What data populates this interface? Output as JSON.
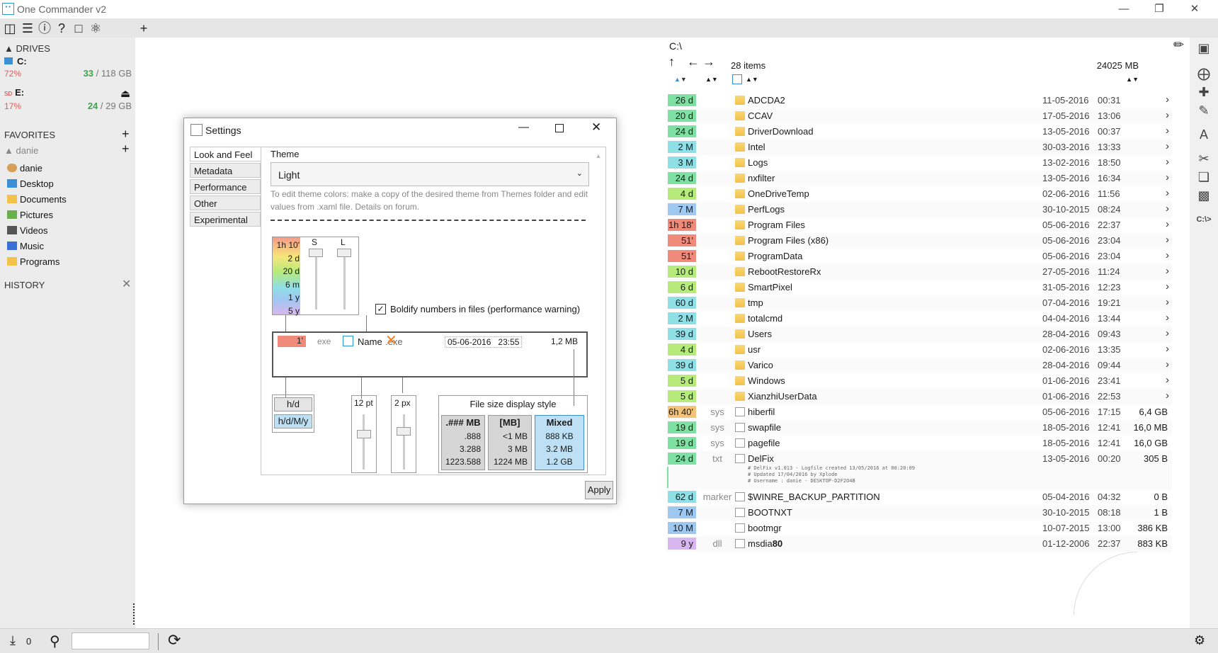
{
  "window": {
    "title": "One Commander v2"
  },
  "sidebar": {
    "drives_header": "DRIVES",
    "drives": [
      {
        "letter": "C:",
        "percent": "72%",
        "used": "33",
        "total": " / 118 GB"
      },
      {
        "letter": "E:",
        "percent": "17%",
        "used": "24",
        "total": " / 29 GB",
        "badge": "SD"
      }
    ],
    "favorites_header": "FAVORITES",
    "user": "danie",
    "items": [
      "danie",
      "Desktop",
      "Documents",
      "Pictures",
      "Videos",
      "Music",
      "Programs"
    ],
    "history_header": "HISTORY"
  },
  "statusbar": {
    "count": "0"
  },
  "rightpanel": {
    "path": "C:\\",
    "items_count": "28 items",
    "free_space": "24025 MB",
    "rows": [
      {
        "age": "26 d",
        "color": "#7ee0a3",
        "ext": "",
        "type": "folder",
        "name": "ADCDA2",
        "date": "11-05-2016",
        "time": "00:31",
        "size": ""
      },
      {
        "age": "20 d",
        "color": "#7ee0a3",
        "ext": "",
        "type": "folder",
        "name": "CCAV",
        "date": "17-05-2016",
        "time": "13:06",
        "size": ""
      },
      {
        "age": "24 d",
        "color": "#7ee0a3",
        "ext": "",
        "type": "folder",
        "name": "DriverDownload",
        "date": "13-05-2016",
        "time": "00:37",
        "size": ""
      },
      {
        "age": "2 M",
        "color": "#8fdfe6",
        "ext": "",
        "type": "folder",
        "name": "Intel",
        "date": "30-03-2016",
        "time": "13:33",
        "size": ""
      },
      {
        "age": "3 M",
        "color": "#8fdfe6",
        "ext": "",
        "type": "folder",
        "name": "Logs",
        "date": "13-02-2016",
        "time": "18:50",
        "size": ""
      },
      {
        "age": "24 d",
        "color": "#7ee0a3",
        "ext": "",
        "type": "folder",
        "name": "nxfilter",
        "date": "13-05-2016",
        "time": "16:34",
        "size": ""
      },
      {
        "age": "4 d",
        "color": "#b6ea7a",
        "ext": "",
        "type": "folder",
        "name": "OneDriveTemp",
        "date": "02-06-2016",
        "time": "11:56",
        "size": ""
      },
      {
        "age": "7 M",
        "color": "#9fc8f0",
        "ext": "",
        "type": "folder",
        "name": "PerfLogs",
        "date": "30-10-2015",
        "time": "08:24",
        "size": ""
      },
      {
        "age": "1h 18'",
        "color": "#f08a7a",
        "ext": "",
        "type": "folder",
        "name": "Program Files",
        "date": "05-06-2016",
        "time": "22:37",
        "size": ""
      },
      {
        "age": "51'",
        "color": "#f08a7a",
        "ext": "",
        "type": "folder",
        "name": "Program Files (x86)",
        "date": "05-06-2016",
        "time": "23:04",
        "size": ""
      },
      {
        "age": "51'",
        "color": "#f08a7a",
        "ext": "",
        "type": "folder",
        "name": "ProgramData",
        "date": "05-06-2016",
        "time": "23:04",
        "size": ""
      },
      {
        "age": "10 d",
        "color": "#b6ea7a",
        "ext": "",
        "type": "folder",
        "name": "RebootRestoreRx",
        "date": "27-05-2016",
        "time": "11:24",
        "size": ""
      },
      {
        "age": "6 d",
        "color": "#b6ea7a",
        "ext": "",
        "type": "folder",
        "name": "SmartPixel",
        "date": "31-05-2016",
        "time": "12:23",
        "size": ""
      },
      {
        "age": "60 d",
        "color": "#8fdfe6",
        "ext": "",
        "type": "folder",
        "name": "tmp",
        "date": "07-04-2016",
        "time": "19:21",
        "size": ""
      },
      {
        "age": "2 M",
        "color": "#8fdfe6",
        "ext": "",
        "type": "folder",
        "name": "totalcmd",
        "date": "04-04-2016",
        "time": "13:44",
        "size": ""
      },
      {
        "age": "39 d",
        "color": "#8fdfe6",
        "ext": "",
        "type": "folder",
        "name": "Users",
        "date": "28-04-2016",
        "time": "09:43",
        "size": ""
      },
      {
        "age": "4 d",
        "color": "#b6ea7a",
        "ext": "",
        "type": "folder",
        "name": "usr",
        "date": "02-06-2016",
        "time": "13:35",
        "size": ""
      },
      {
        "age": "39 d",
        "color": "#8fdfe6",
        "ext": "",
        "type": "folder",
        "name": "Varico",
        "date": "28-04-2016",
        "time": "09:44",
        "size": ""
      },
      {
        "age": "5 d",
        "color": "#b6ea7a",
        "ext": "",
        "type": "folder",
        "name": "Windows",
        "date": "01-06-2016",
        "time": "23:41",
        "size": ""
      },
      {
        "age": "5 d",
        "color": "#b6ea7a",
        "ext": "",
        "type": "folder",
        "name": "XianzhiUserData",
        "date": "01-06-2016",
        "time": "22:53",
        "size": ""
      },
      {
        "age": "6h 40'",
        "color": "#f3c37a",
        "ext": "sys",
        "type": "file",
        "name": "hiberfil",
        "date": "05-06-2016",
        "time": "17:15",
        "size": "6,4 GB"
      },
      {
        "age": "19 d",
        "color": "#7ee0a3",
        "ext": "sys",
        "type": "file",
        "name": "swapfile",
        "date": "18-05-2016",
        "time": "12:41",
        "size": "16,0 MB"
      },
      {
        "age": "19 d",
        "color": "#7ee0a3",
        "ext": "sys",
        "type": "file",
        "name": "pagefile",
        "date": "18-05-2016",
        "time": "12:41",
        "size": "16,0 GB"
      },
      {
        "age": "24 d",
        "color": "#7ee0a3",
        "ext": "txt",
        "type": "file",
        "name": "DelFix",
        "date": "13-05-2016",
        "time": "00:20",
        "size": "305 B"
      },
      {
        "age": "62 d",
        "color": "#8fdfe6",
        "ext": "marker",
        "type": "file",
        "name": "$WINRE_BACKUP_PARTITION",
        "date": "05-04-2016",
        "time": "04:32",
        "size": "0 B"
      },
      {
        "age": "7 M",
        "color": "#9fc8f0",
        "ext": "",
        "type": "file",
        "name": "BOOTNXT",
        "date": "30-10-2015",
        "time": "08:18",
        "size": "1 B"
      },
      {
        "age": "10 M",
        "color": "#9fc8f0",
        "ext": "",
        "type": "file",
        "name": "bootmgr",
        "date": "10-07-2015",
        "time": "13:00",
        "size": "386 KB"
      },
      {
        "age": "9 y",
        "color": "#d8b6f0",
        "ext": "dll",
        "type": "file",
        "name": "msdia80",
        "date": "01-12-2006",
        "time": "22:37",
        "size": "883 KB"
      }
    ],
    "delfix_notes": [
      "# DelFix v1.013 - Logfile created 13/05/2016 at 00:20:09",
      "# Updated 17/04/2016 by Xplode",
      "# Username : danie - DESKTOP-D2F2O4B"
    ]
  },
  "settings": {
    "title": "Settings",
    "tabs": [
      "Look and Feel",
      "Metadata",
      "Performance",
      "Other",
      "Experimental"
    ],
    "theme_label": "Theme",
    "theme_value": "Light",
    "hint": "To edit theme colors: make a copy of the desired theme from Themes folder and edit values from .xaml file. Details on forum.",
    "scale_labels": [
      "1h 10'",
      "2 d",
      "20 d",
      "6 m",
      "1 y",
      "5 y"
    ],
    "slider_s": "S",
    "slider_l": "L",
    "boldify_label": "Boldify numbers in files (performance warning)",
    "preview": {
      "age": "1'",
      "ext": "exe",
      "name": "Name",
      "ext2": ".exe",
      "date": "05-06-2016",
      "time": "23:55",
      "size": "1,2 MB"
    },
    "hd_button": "h/d",
    "hdmy_button": "h/d/M/y",
    "font_size": "12 pt",
    "padding": "2 px",
    "filesize_title": "File size display style",
    "filesize_cols": [
      {
        "head": ".### MB",
        "vals": [
          ".888",
          "3.288",
          "1223.588"
        ]
      },
      {
        "head": "[MB]",
        "vals": [
          "<1 MB",
          "3 MB",
          "1224 MB"
        ]
      },
      {
        "head": "Mixed",
        "vals": [
          "888 KB",
          "3.2 MB",
          "1.2 GB"
        ]
      }
    ],
    "apply_button": "Apply"
  }
}
